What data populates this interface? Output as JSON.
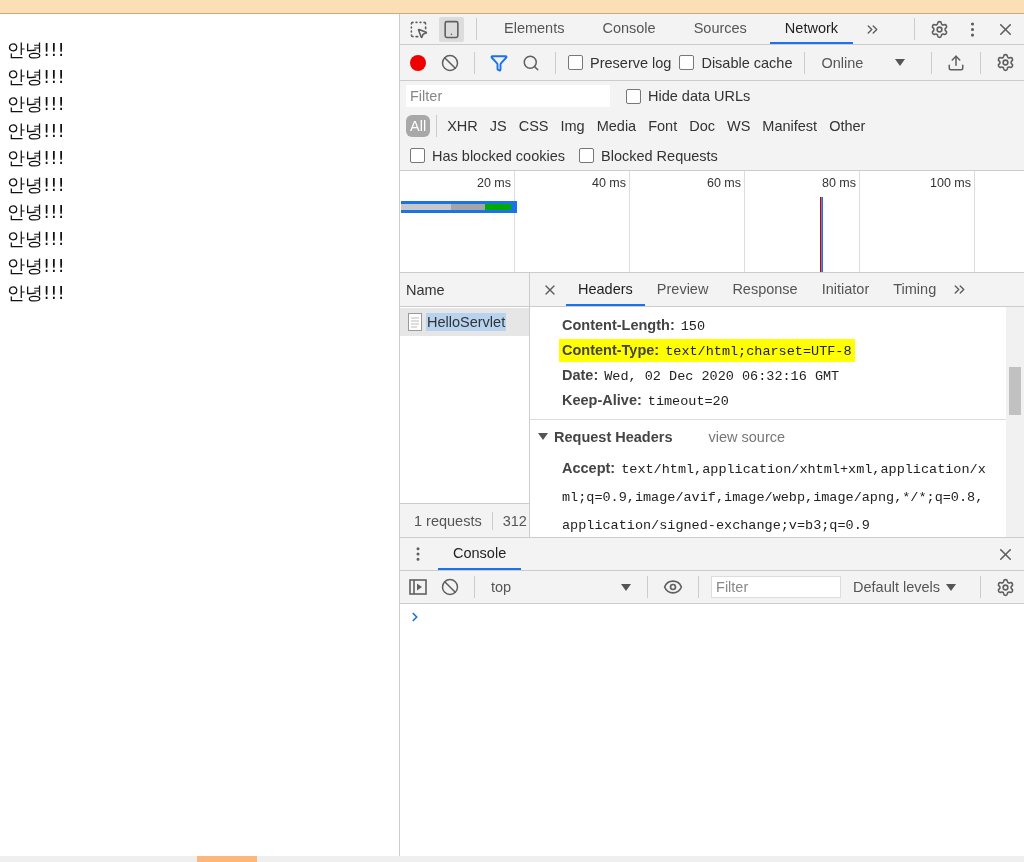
{
  "page": {
    "lines": [
      "안녕!!!",
      "안녕!!!",
      "안녕!!!",
      "안녕!!!",
      "안녕!!!",
      "안녕!!!",
      "안녕!!!",
      "안녕!!!",
      "안녕!!!",
      "안녕!!!"
    ]
  },
  "devtools": {
    "device_toolbar_on": true,
    "tabs": [
      {
        "label": "Elements",
        "selected": false
      },
      {
        "label": "Console",
        "selected": false
      },
      {
        "label": "Sources",
        "selected": false
      },
      {
        "label": "Network",
        "selected": true
      }
    ],
    "network_toolbar": {
      "recording": true,
      "filter_on": true,
      "preserve_log": false,
      "disable_cache": false,
      "throttling": "Online"
    },
    "filter": {
      "placeholder": "Filter",
      "hide_data_urls": false,
      "hide_data_urls_label": "Hide data URLs"
    },
    "types": [
      {
        "label": "All",
        "selected": true
      },
      {
        "label": "XHR",
        "selected": false
      },
      {
        "label": "JS",
        "selected": false
      },
      {
        "label": "CSS",
        "selected": false
      },
      {
        "label": "Img",
        "selected": false
      },
      {
        "label": "Media",
        "selected": false
      },
      {
        "label": "Font",
        "selected": false
      },
      {
        "label": "Doc",
        "selected": false
      },
      {
        "label": "WS",
        "selected": false
      },
      {
        "label": "Manifest",
        "selected": false
      },
      {
        "label": "Other",
        "selected": false
      }
    ],
    "blocked": [
      {
        "label": "Has blocked cookies",
        "checked": false
      },
      {
        "label": "Blocked Requests",
        "checked": false
      }
    ],
    "preserve_log_label": "Preserve log",
    "disable_cache_label": "Disable cache",
    "timeline": {
      "ticks": [
        "20 ms",
        "40 ms",
        "60 ms",
        "80 ms",
        "100 ms"
      ]
    },
    "requests": {
      "column": "Name",
      "rows": [
        {
          "name": "HelloServlet",
          "selected": true
        }
      ],
      "summary": [
        "1 requests",
        "312"
      ]
    },
    "detail_tabs": [
      {
        "label": "Headers",
        "selected": true
      },
      {
        "label": "Preview",
        "selected": false
      },
      {
        "label": "Response",
        "selected": false
      },
      {
        "label": "Initiator",
        "selected": false
      },
      {
        "label": "Timing",
        "selected": false
      }
    ],
    "response_headers": [
      {
        "name": "Content-Length:",
        "value": "150",
        "highlighted": false
      },
      {
        "name": "Content-Type:",
        "value": "text/html;charset=UTF-8",
        "highlighted": true
      },
      {
        "name": "Date:",
        "value": "Wed, 02 Dec 2020 06:32:16 GMT",
        "highlighted": false
      },
      {
        "name": "Keep-Alive:",
        "value": "timeout=20",
        "highlighted": false
      }
    ],
    "request_headers": {
      "title": "Request Headers",
      "expanded": true,
      "link": "view source",
      "rows": [
        {
          "name": "Accept:",
          "value": "text/html,application/xhtml+xml,application/xml;q=0.9,image/avif,image/webp,image/apng,*/*;q=0.8,application/signed-exchange;v=b3;q=0.9"
        }
      ]
    },
    "drawer": {
      "tabs": [
        {
          "label": "Console",
          "selected": true
        }
      ],
      "context": "top",
      "filter_placeholder": "Filter",
      "levels": "Default levels"
    }
  }
}
